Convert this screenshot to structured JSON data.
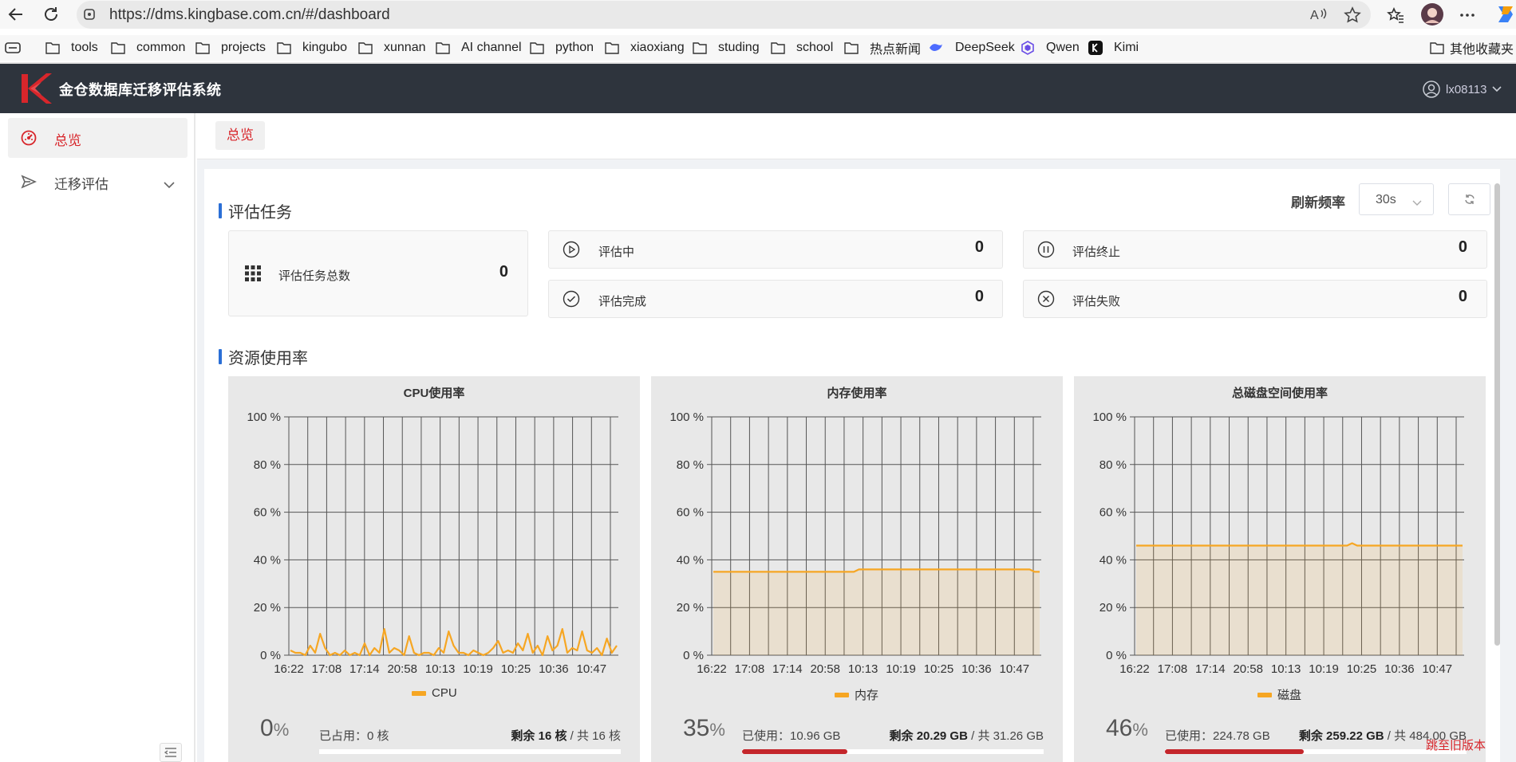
{
  "browser": {
    "url": "https://dms.kingbase.com.cn/#/dashboard",
    "bookmarks": [
      {
        "label": "tools",
        "icon": "folder-icon"
      },
      {
        "label": "common",
        "icon": "folder-icon"
      },
      {
        "label": "projects",
        "icon": "folder-icon"
      },
      {
        "label": "kingubo",
        "icon": "folder-icon"
      },
      {
        "label": "xunnan",
        "icon": "folder-icon"
      },
      {
        "label": "AI channel",
        "icon": "folder-icon"
      },
      {
        "label": "python",
        "icon": "folder-icon"
      },
      {
        "label": "xiaoxiang",
        "icon": "folder-icon"
      },
      {
        "label": "studing",
        "icon": "folder-icon"
      },
      {
        "label": "school",
        "icon": "folder-icon"
      },
      {
        "label": "热点新闻",
        "icon": "folder-icon"
      },
      {
        "label": "DeepSeek",
        "icon": "deepseek-icon"
      },
      {
        "label": "Qwen",
        "icon": "qwen-icon"
      },
      {
        "label": "Kimi",
        "icon": "kimi-icon"
      }
    ],
    "other_bookmarks": "其他收藏夹"
  },
  "app": {
    "title": "金仓数据库迁移评估系统",
    "username": "lx08113"
  },
  "sidebar": {
    "items": [
      {
        "label": "总览",
        "icon": "dashboard-icon",
        "active": true
      },
      {
        "label": "迁移评估",
        "icon": "send-icon",
        "active": false
      }
    ]
  },
  "tabs": {
    "active": "总览"
  },
  "tasks": {
    "section_title": "评估任务",
    "refresh_label": "刷新频率",
    "refresh_value": "30s",
    "total": {
      "label": "评估任务总数",
      "value": "0"
    },
    "running": {
      "label": "评估中",
      "value": "0"
    },
    "stopped": {
      "label": "评估终止",
      "value": "0"
    },
    "done": {
      "label": "评估完成",
      "value": "0"
    },
    "failed": {
      "label": "评估失败",
      "value": "0"
    }
  },
  "resources": {
    "section_title": "资源使用率",
    "old_version_link": "跳至旧版本",
    "cpu": {
      "title": "CPU使用率",
      "legend": "CPU",
      "percent": "0",
      "unit": "%",
      "used_text": "已占用：0 核",
      "remaining_label": "剩余",
      "remaining_value": "16 核",
      "total_text": "/ 共 16 核",
      "used_fraction": 0
    },
    "memory": {
      "title": "内存使用率",
      "legend": "内存",
      "percent": "35",
      "unit": "%",
      "used_text": "已使用：10.96 GB",
      "remaining_label": "剩余",
      "remaining_value": "20.29 GB",
      "total_text": "/ 共 31.26 GB",
      "used_fraction": 0.35
    },
    "disk": {
      "title": "总磁盘空间使用率",
      "legend": "磁盘",
      "percent": "46",
      "unit": "%",
      "used_text": "已使用：224.78 GB",
      "remaining_label": "剩余",
      "remaining_value": "259.22 GB",
      "total_text": "/ 共 484.00 GB",
      "used_fraction": 0.46
    }
  },
  "chart_data": [
    {
      "type": "line",
      "title": "CPU使用率",
      "categories": [
        "16:22",
        "17:08",
        "17:14",
        "20:58",
        "10:13",
        "10:19",
        "10:25",
        "10:36",
        "10:47"
      ],
      "yticks": [
        "0 %",
        "20 %",
        "40 %",
        "60 %",
        "80 %",
        "100 %"
      ],
      "ylim": [
        0,
        100
      ],
      "series": [
        {
          "name": "CPU",
          "color": "#f6a623",
          "area": false,
          "values": [
            2,
            1,
            1,
            0,
            4,
            1,
            9,
            3,
            0,
            1,
            0,
            2,
            0,
            1,
            0,
            5,
            0,
            3,
            1,
            11,
            1,
            3,
            2,
            0,
            8,
            1,
            0,
            1,
            1,
            0,
            3,
            1,
            10,
            4,
            1,
            1,
            0,
            2,
            1,
            0,
            1,
            3,
            6,
            1,
            2,
            1,
            5,
            2,
            9,
            1,
            4,
            0,
            8,
            2,
            4,
            11,
            1,
            3,
            2,
            10,
            2,
            1,
            3,
            0,
            7,
            1,
            4
          ]
        }
      ],
      "legend": "bottom"
    },
    {
      "type": "area",
      "title": "内存使用率",
      "categories": [
        "16:22",
        "17:08",
        "17:14",
        "20:58",
        "10:13",
        "10:19",
        "10:25",
        "10:36",
        "10:47"
      ],
      "yticks": [
        "0 %",
        "20 %",
        "40 %",
        "60 %",
        "80 %",
        "100 %"
      ],
      "ylim": [
        0,
        100
      ],
      "series": [
        {
          "name": "内存",
          "color": "#f6a623",
          "area": true,
          "values": [
            35,
            35,
            35,
            35,
            35,
            35,
            35,
            35,
            35,
            35,
            35,
            35,
            35,
            35,
            35,
            35,
            35,
            35,
            35,
            35,
            35,
            35,
            35,
            35,
            35,
            35,
            35,
            35,
            35,
            36,
            36,
            36,
            36,
            36,
            36,
            36,
            36,
            36,
            36,
            36,
            36,
            36,
            36,
            36,
            36,
            36,
            36,
            36,
            36,
            36,
            36,
            36,
            36,
            36,
            36,
            36,
            36,
            36,
            36,
            36,
            36,
            36,
            36,
            36,
            35,
            35
          ]
        }
      ],
      "legend": "bottom"
    },
    {
      "type": "area",
      "title": "总磁盘空间使用率",
      "categories": [
        "16:22",
        "17:08",
        "17:14",
        "20:58",
        "10:13",
        "10:19",
        "10:25",
        "10:36",
        "10:47"
      ],
      "yticks": [
        "0 %",
        "20 %",
        "40 %",
        "60 %",
        "80 %",
        "100 %"
      ],
      "ylim": [
        0,
        100
      ],
      "series": [
        {
          "name": "磁盘",
          "color": "#f6a623",
          "area": true,
          "values": [
            46,
            46,
            46,
            46,
            46,
            46,
            46,
            46,
            46,
            46,
            46,
            46,
            46,
            46,
            46,
            46,
            46,
            46,
            46,
            46,
            46,
            46,
            46,
            46,
            46,
            46,
            46,
            46,
            46,
            46,
            46,
            46,
            46,
            46,
            46,
            46,
            46,
            46,
            46,
            46,
            46,
            46,
            46,
            47,
            46,
            46,
            46,
            46,
            46,
            46,
            46,
            46,
            46,
            46,
            46,
            46,
            46,
            46,
            46,
            46,
            46,
            46,
            46,
            46,
            46,
            46
          ]
        }
      ],
      "legend": "bottom"
    }
  ]
}
